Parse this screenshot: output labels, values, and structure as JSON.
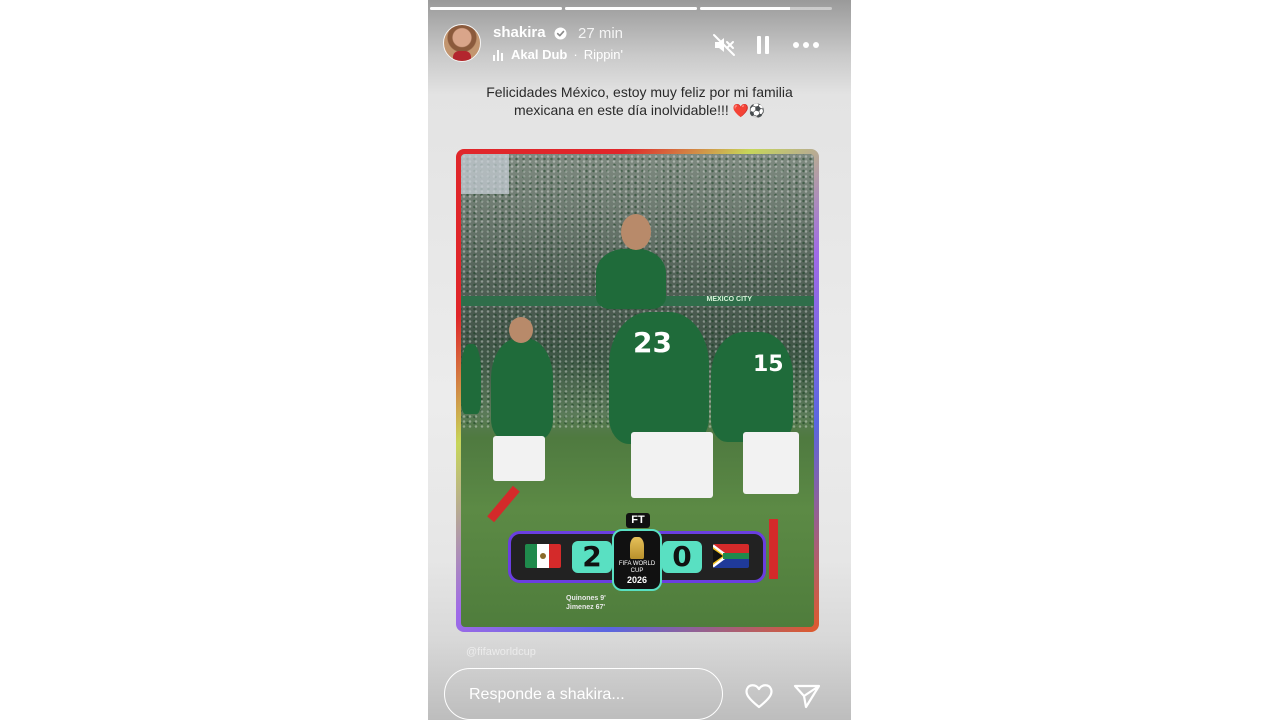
{
  "story": {
    "progress": [
      1.0,
      1.0,
      0.68
    ],
    "username": "shakira",
    "verified": true,
    "time_ago": "27 min",
    "music": {
      "artist": "Akal Dub",
      "separator": "·",
      "track": "Rippin'"
    },
    "caption_line1": "Felicidades México, estoy muy feliz por mi familia",
    "caption_line2": "mexicana en este día inolvidable!!!",
    "caption_emoji": "❤️⚽",
    "controls": [
      "muted-icon",
      "pause-icon",
      "more-icon"
    ]
  },
  "post": {
    "stadium_banner": "MEXICO CITY",
    "jersey_number": "23",
    "jersey_number_right": "15",
    "scoreboard": {
      "status": "FT",
      "home_score": "2",
      "away_score": "0",
      "home_flag": "mexico-flag",
      "away_flag": "south-africa-flag",
      "tournament": "FIFA WORLD CUP",
      "year": "2026"
    },
    "scorers": [
      "Quinones 9'",
      "Jimenez 67'"
    ],
    "watermark": "@fifaworldcup"
  },
  "footer": {
    "reply_placeholder": "Responde a shakira...",
    "like_icon": "heart-icon",
    "share_icon": "send-icon"
  },
  "colors": {
    "mexico_green": "#1f6b3a",
    "score_teal": "#59e0c2",
    "frame_red": "#e0262a",
    "frame_purple": "#a06ae8"
  }
}
